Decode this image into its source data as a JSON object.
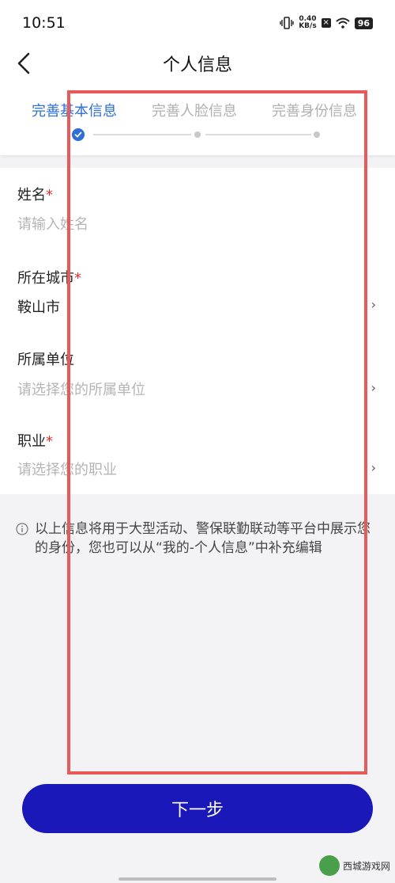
{
  "status_bar": {
    "time": "10:51",
    "net_speed_value": "0.40",
    "net_speed_unit": "KB/s",
    "battery": "96"
  },
  "nav": {
    "title": "个人信息"
  },
  "stepper": {
    "steps": [
      {
        "label": "完善基本信息",
        "state": "active"
      },
      {
        "label": "完善人脸信息",
        "state": "pending"
      },
      {
        "label": "完善身份信息",
        "state": "pending"
      }
    ],
    "active_color": "#2e6fd6"
  },
  "form": {
    "fields": [
      {
        "label": "姓名",
        "required_mark": "*",
        "placeholder": "请输入姓名",
        "value": ""
      },
      {
        "label": "所在城市",
        "required_mark": "*",
        "placeholder": "",
        "value": "鞍山市"
      },
      {
        "label": "所属单位",
        "required_mark": "",
        "placeholder": "请选择您的所属单位",
        "value": ""
      },
      {
        "label": "职业",
        "required_mark": "*",
        "placeholder": "请选择您的职业",
        "value": ""
      }
    ],
    "chevron": "›"
  },
  "note": {
    "text": "以上信息将用于大型活动、警保联勤联动等平台中展示您的身份，您也可以从“我的-个人信息”中补充编辑"
  },
  "footer": {
    "next_label": "下一步",
    "button_color": "#1a18b8"
  },
  "watermark": {
    "text": "西城游戏网"
  }
}
